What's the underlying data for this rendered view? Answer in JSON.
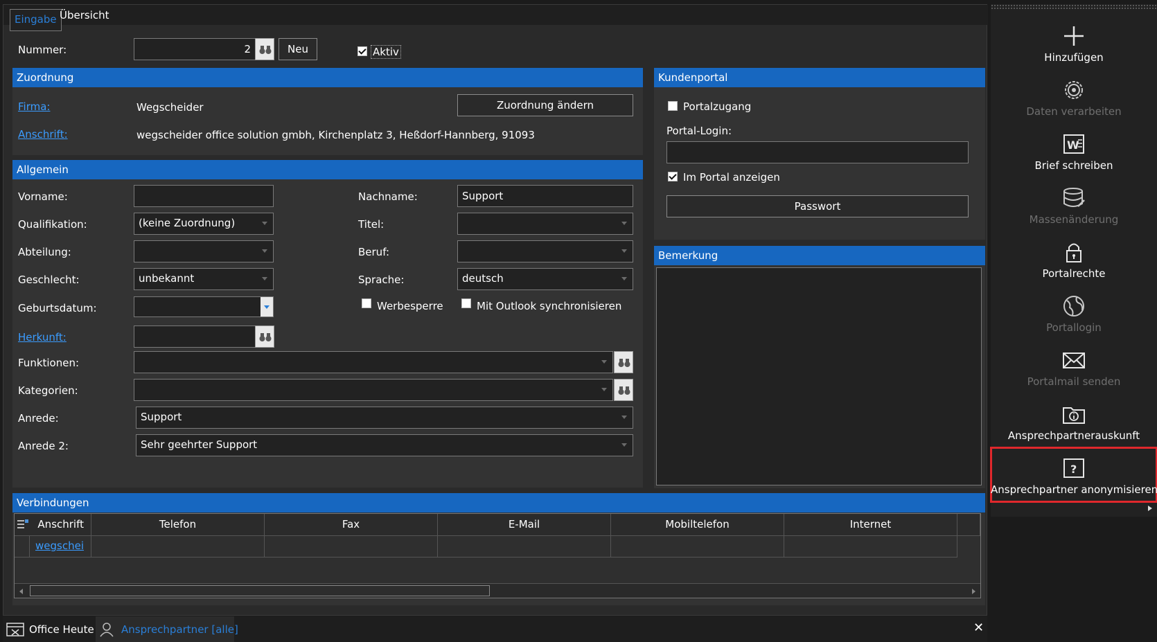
{
  "tabs": [
    {
      "label": "Eingabe"
    },
    {
      "label": "Übersicht"
    }
  ],
  "nummer": {
    "label": "Nummer:",
    "value": "2",
    "new_label": "Neu",
    "aktiv_label": "Aktiv",
    "aktiv_checked": true
  },
  "zuordnung": {
    "title": "Zuordnung",
    "firma_label": "Firma:",
    "firma_value": "Wegscheider",
    "anschrift_label": "Anschrift:",
    "anschrift_value": "wegscheider office solution gmbh, Kirchenplatz 3, Heßdorf-Hannberg, 91093",
    "change_button": "Zuordnung ändern"
  },
  "allgemein": {
    "title": "Allgemein",
    "vorname_label": "Vorname:",
    "vorname_value": "",
    "nachname_label": "Nachname:",
    "nachname_value": "Support",
    "qualifikation_label": "Qualifikation:",
    "qualifikation_value": "(keine Zuordnung)",
    "titel_label": "Titel:",
    "titel_value": "",
    "abteilung_label": "Abteilung:",
    "abteilung_value": "",
    "beruf_label": "Beruf:",
    "beruf_value": "",
    "geschlecht_label": "Geschlecht:",
    "geschlecht_value": "unbekannt",
    "sprache_label": "Sprache:",
    "sprache_value": "deutsch",
    "geburtsdatum_label": "Geburtsdatum:",
    "geburtsdatum_value": "",
    "werbesperre_label": "Werbesperre",
    "outlook_label": "Mit Outlook synchronisieren",
    "herkunft_label": "Herkunft:",
    "herkunft_value": "",
    "funktionen_label": "Funktionen:",
    "funktionen_value": "",
    "kategorien_label": "Kategorien:",
    "kategorien_value": "",
    "anrede_label": "Anrede:",
    "anrede_value": "Support",
    "anrede2_label": "Anrede 2:",
    "anrede2_value": "Sehr geehrter Support"
  },
  "kundenportal": {
    "title": "Kundenportal",
    "portalzugang_label": "Portalzugang",
    "portalzugang_checked": false,
    "login_label": "Portal-Login:",
    "login_value": "",
    "anzeigen_label": "Im Portal anzeigen",
    "anzeigen_checked": true,
    "passwort_button": "Passwort"
  },
  "bemerkung": {
    "title": "Bemerkung",
    "value": ""
  },
  "verbindungen": {
    "title": "Verbindungen",
    "columns": [
      "Anschrift",
      "Telefon",
      "Fax",
      "E-Mail",
      "Mobiltelefon",
      "Internet"
    ],
    "rows": [
      {
        "anschrift": "wegschei"
      }
    ]
  },
  "sidebar": {
    "items": [
      {
        "label": "Hinzufügen",
        "icon": "plus-icon",
        "enabled": true
      },
      {
        "label": "Daten verarbeiten",
        "icon": "gear-icon",
        "enabled": false
      },
      {
        "label": "Brief schreiben",
        "icon": "word-icon",
        "enabled": true
      },
      {
        "label": "Massenänderung",
        "icon": "database-edit-icon",
        "enabled": false
      },
      {
        "label": "Portalrechte",
        "icon": "lock-icon",
        "enabled": true
      },
      {
        "label": "Portallogin",
        "icon": "globe-icon",
        "enabled": false
      },
      {
        "label": "Portalmail senden",
        "icon": "mail-icon",
        "enabled": false
      },
      {
        "label": "Ansprechpartnerauskunft",
        "icon": "folder-info-icon",
        "enabled": true
      },
      {
        "label": "Ansprechpartner anonymisieren",
        "icon": "question-box-icon",
        "enabled": true,
        "highlighted": true
      }
    ]
  },
  "bottom": {
    "tab1": "Office Heute",
    "tab2": "Ansprechpartner [alle]"
  },
  "colors": {
    "accent": "#1767c0",
    "link": "#3b9cff",
    "highlight": "#e0282c"
  }
}
